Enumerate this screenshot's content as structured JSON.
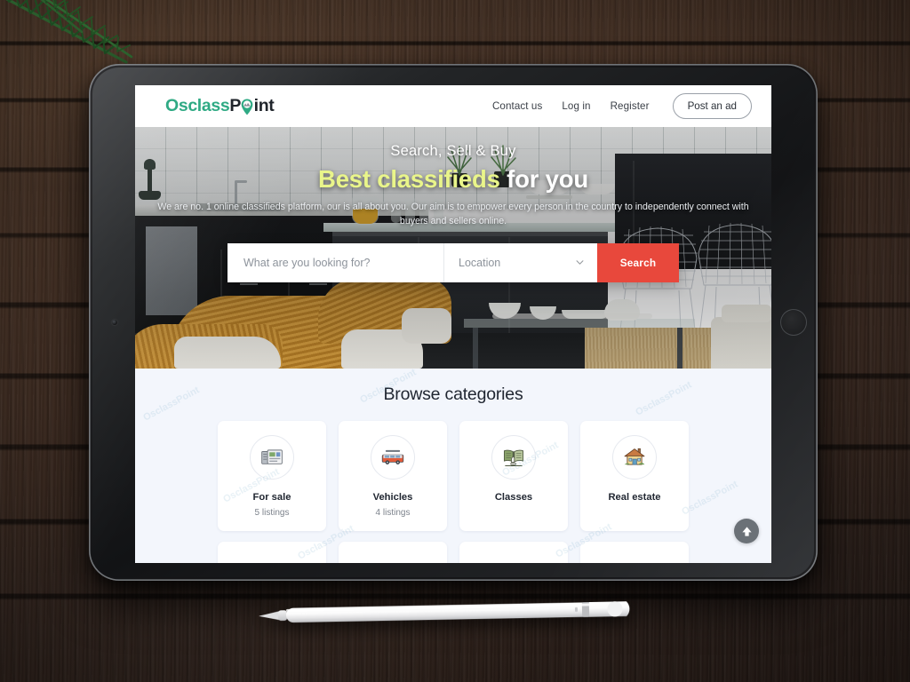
{
  "site": {
    "logo": {
      "part1": "Osclass",
      "part2a": "P",
      "part2b": "int",
      "pin_icon": "map-pin-icon",
      "color_green": "#2FAA84",
      "color_dark": "#20252B"
    }
  },
  "header": {
    "nav": [
      {
        "label": "Contact us",
        "name": "nav-contact-us"
      },
      {
        "label": "Log in",
        "name": "nav-log-in"
      },
      {
        "label": "Register",
        "name": "nav-register"
      }
    ],
    "cta": {
      "label": "Post an ad"
    }
  },
  "hero": {
    "kicker": "Search, Sell & Buy",
    "title_highlight": "Best classifieds",
    "title_rest": " for you",
    "highlight_color": "#E9F58A",
    "subtitle": "We are no. 1 online classifieds platform, our is all about you. Our aim is to empower every person in the country to independently connect with buyers and sellers online.",
    "search": {
      "keyword_placeholder": "What are you looking for?",
      "keyword_value": "",
      "location_label": "Location",
      "location_options": [
        "Location"
      ],
      "submit_label": "Search",
      "submit_color": "#E8483C",
      "chevron_icon": "chevron-down-icon"
    }
  },
  "categories": {
    "title": "Browse categories",
    "background": "#F3F6FC",
    "items": [
      {
        "name": "For sale",
        "count": "5 listings",
        "icon": "newspaper-icon"
      },
      {
        "name": "Vehicles",
        "count": "4 listings",
        "icon": "van-icon"
      },
      {
        "name": "Classes",
        "count": "",
        "icon": "open-book-icon"
      },
      {
        "name": "Real estate",
        "count": "",
        "icon": "house-icon"
      }
    ],
    "watermark_text": "OsclassPoint"
  },
  "scroll_top": {
    "icon": "arrow-up-circle-icon",
    "label": ""
  },
  "device": {
    "type": "tablet",
    "accessory": "stylus-pen"
  }
}
